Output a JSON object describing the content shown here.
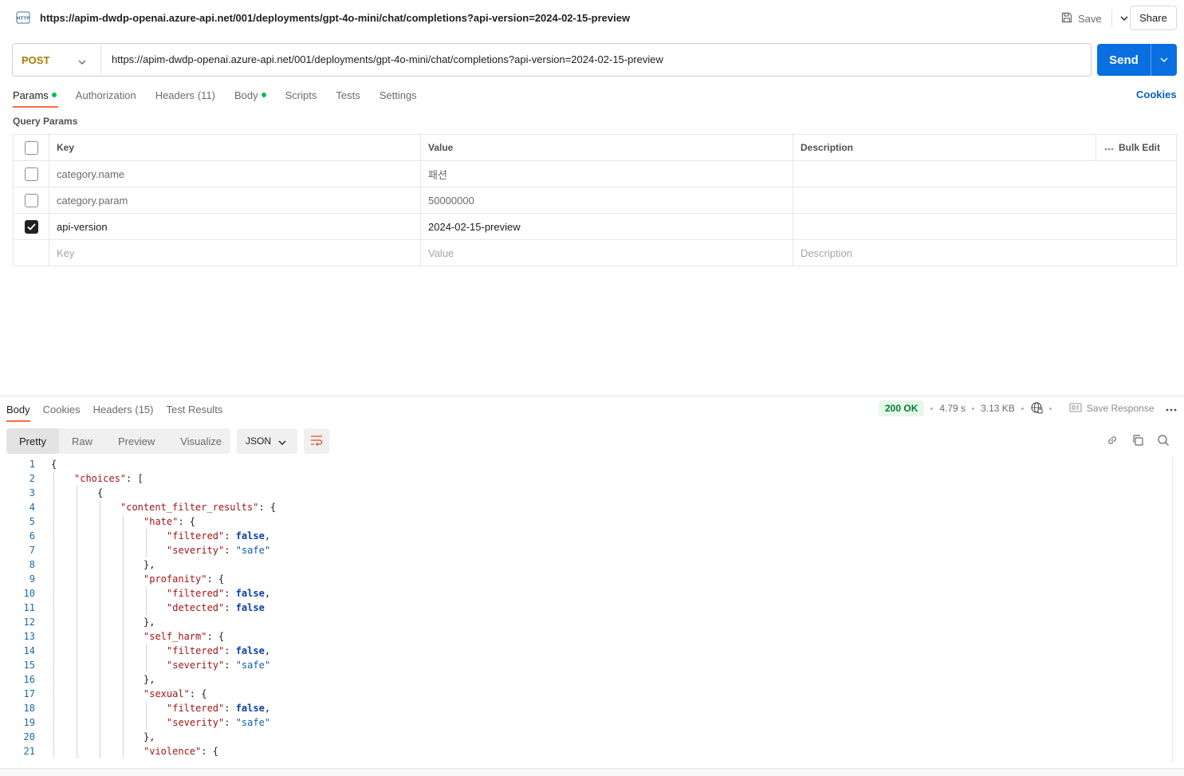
{
  "titlebar": {
    "url": "https://apim-dwdp-openai.azure-api.net/001/deployments/gpt-4o-mini/chat/completions?api-version=2024-02-15-preview",
    "save_label": "Save",
    "share_label": "Share"
  },
  "request": {
    "method": "POST",
    "url": "https://apim-dwdp-openai.azure-api.net/001/deployments/gpt-4o-mini/chat/completions?api-version=2024-02-15-preview",
    "send_label": "Send"
  },
  "req_tabs": {
    "params": "Params",
    "authorization": "Authorization",
    "headers": "Headers",
    "headers_count": "(11)",
    "body": "Body",
    "scripts": "Scripts",
    "tests": "Tests",
    "settings": "Settings",
    "cookies": "Cookies"
  },
  "query_params": {
    "title": "Query Params",
    "col_key": "Key",
    "col_value": "Value",
    "col_description": "Description",
    "bulk_edit": "Bulk Edit",
    "rows": [
      {
        "key": "category.name",
        "value": "패션",
        "checked": false
      },
      {
        "key": "category.param",
        "value": "50000000",
        "checked": false
      },
      {
        "key": "api-version",
        "value": "2024-02-15-preview",
        "checked": true
      }
    ],
    "placeholder_key": "Key",
    "placeholder_value": "Value",
    "placeholder_description": "Description"
  },
  "response": {
    "tabs": {
      "body": "Body",
      "cookies": "Cookies",
      "headers": "Headers",
      "headers_count": "(15)",
      "test_results": "Test Results"
    },
    "status": "200 OK",
    "time": "4.79 s",
    "size": "3.13 KB",
    "save_response": "Save Response",
    "views": {
      "pretty": "Pretty",
      "raw": "Raw",
      "preview": "Preview",
      "visualize": "Visualize"
    },
    "format": "JSON"
  },
  "code_lines": [
    "{",
    "\"choices\": [",
    "{",
    "\"content_filter_results\": {",
    "\"hate\": {",
    "\"filtered\": false,",
    "\"severity\": \"safe\"",
    "},",
    "\"profanity\": {",
    "\"filtered\": false,",
    "\"detected\": false",
    "},",
    "\"self_harm\": {",
    "\"filtered\": false,",
    "\"severity\": \"safe\"",
    "},",
    "\"sexual\": {",
    "\"filtered\": false,",
    "\"severity\": \"safe\"",
    "},",
    "\"violence\": {"
  ],
  "colors": {
    "send": "#0a6fe0",
    "method": "#ad7a03",
    "accent_tab": "#ff6c37",
    "status_ok": "#007f31",
    "dot": "#0cbb52"
  }
}
